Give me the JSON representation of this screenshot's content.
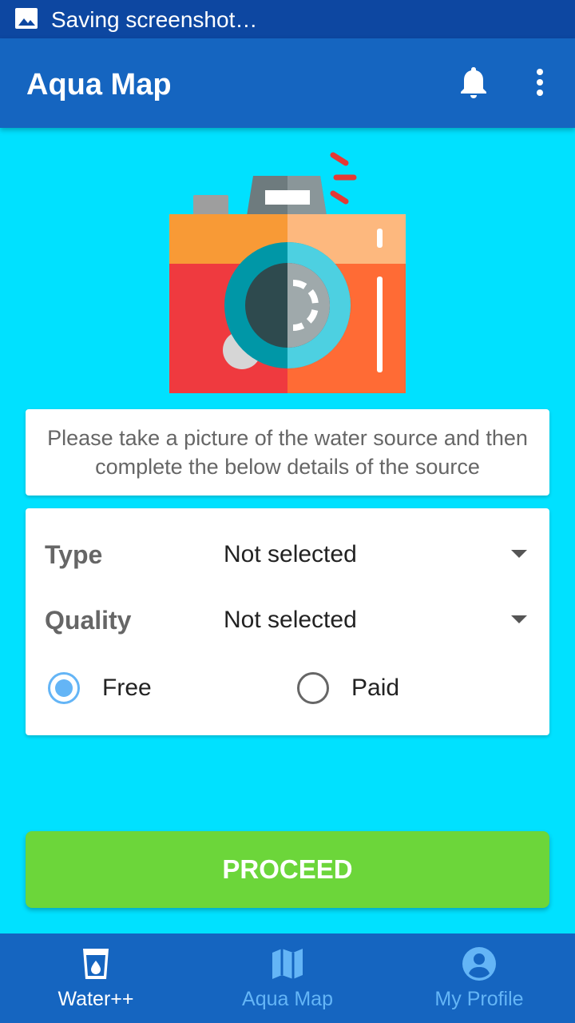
{
  "status_bar": {
    "text": "Saving screenshot…",
    "icon": "image-icon"
  },
  "app_bar": {
    "title": "Aqua Map",
    "icons": [
      "bell-icon",
      "more-vert-icon"
    ]
  },
  "instruction": "Please take a picture of the water source and then complete the below details of the source",
  "form": {
    "type_label": "Type",
    "type_value": "Not selected",
    "quality_label": "Quality",
    "quality_value": "Not selected",
    "payment": {
      "free_label": "Free",
      "paid_label": "Paid",
      "selected": "Free"
    }
  },
  "proceed_label": "PROCEED",
  "bottom_nav": {
    "items": [
      {
        "label": "Water++",
        "icon": "water-glass-icon",
        "active": true
      },
      {
        "label": "Aqua Map",
        "icon": "map-icon",
        "active": false
      },
      {
        "label": "My Profile",
        "icon": "account-icon",
        "active": false
      }
    ]
  },
  "colors": {
    "background": "#00E1FF",
    "app_bar": "#1565C0",
    "status_bar": "#0D47A1",
    "proceed": "#6CD63A",
    "radio_checked": "#64B5F6",
    "nav_inactive": "#64B5F6"
  }
}
